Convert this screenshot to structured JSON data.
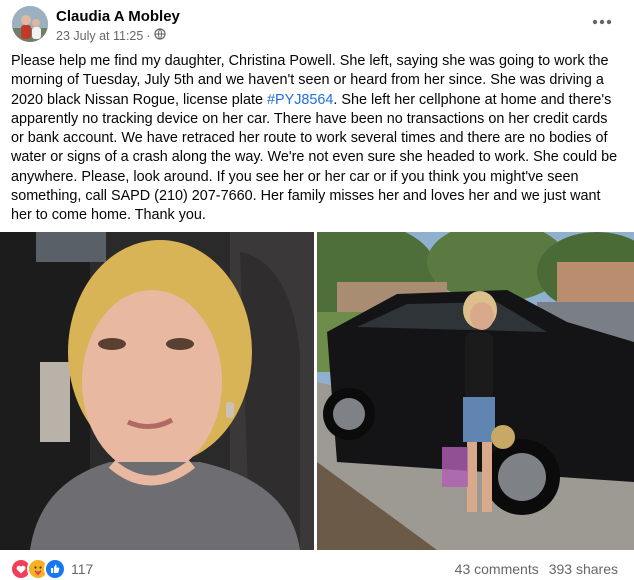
{
  "post": {
    "author": "Claudia A Mobley",
    "timestamp": "23 July at 11:25",
    "separator": "·",
    "audience_icon": "globe-icon",
    "more_icon": "more-options-icon",
    "text_before_tag": "Please help me find my daughter, Christina Powell. She left, saying she was going  to work the morning of Tuesday, July 5th and we haven't seen or heard from her since. She was driving a 2020 black Nissan Rogue, license plate ",
    "hashtag": "#PYJ8564",
    "text_after_tag": ". She left her cellphone at home and there's apparently no tracking device on her car. There have been no transactions on her credit cards or bank account. We have retraced her route to work several times and there are no bodies of water or signs of a crash along the way. We're not even sure she headed to work. She could be anywhere. Please, look around. If you see her or her car or if you think you might've seen something, call SAPD (210) 207-7660. Her family misses her and loves her and we just want her to come home. Thank you."
  },
  "footer": {
    "reaction_icons": [
      "heart-icon",
      "care-icon",
      "like-icon"
    ],
    "reaction_count": "117",
    "comments": "43 comments",
    "shares": "393 shares"
  },
  "colors": {
    "hashtag": "#216fdb",
    "meta_text": "#65676b",
    "like": "#1877f2",
    "heart": "#f33e58",
    "care": "#f7b125"
  }
}
